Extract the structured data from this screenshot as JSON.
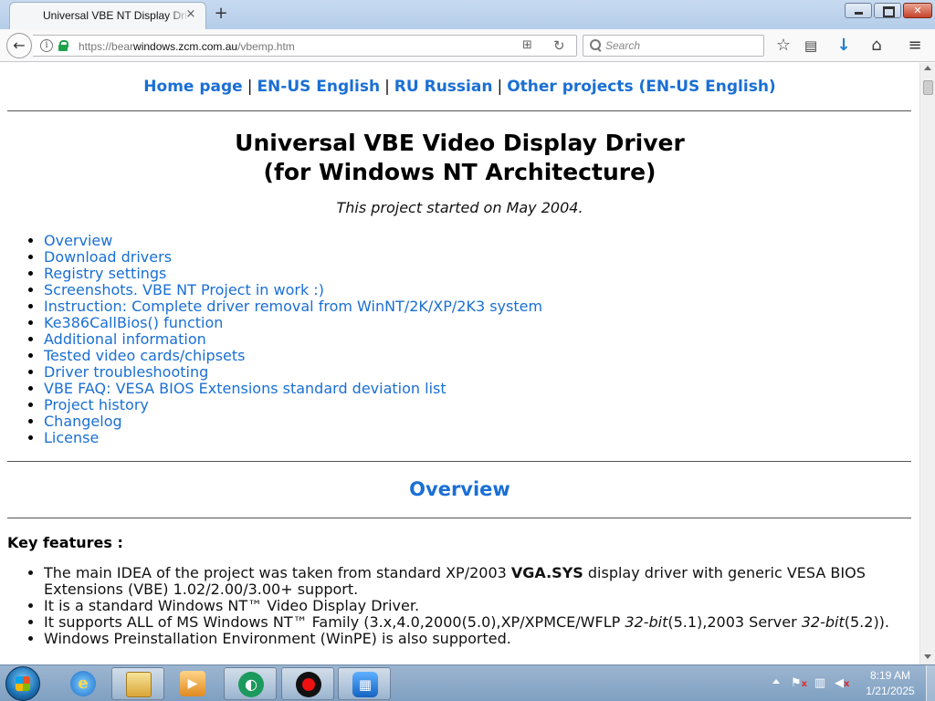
{
  "browser": {
    "tab_title": "Universal VBE NT Display Driver",
    "tab_close": "×",
    "new_tab": "+",
    "url_prefix": "https://bear",
    "url_host": "windows.zcm.com.au",
    "url_path": "/vbemp.htm",
    "search_placeholder": "Search",
    "back_glyph": "←",
    "reader_glyph": "⊞",
    "reload_glyph": "↻",
    "star_glyph": "☆",
    "library_glyph": "▤",
    "download_glyph": "↓",
    "home_glyph": "⌂",
    "menu_glyph": "≡",
    "info_glyph": "i"
  },
  "topnav": {
    "links": [
      "Home page",
      "EN-US English",
      "RU Russian",
      "Other projects (EN-US English)"
    ],
    "separator": "|"
  },
  "page": {
    "title_line1": "Universal VBE Video Display Driver",
    "title_line2": "(for Windows NT Architecture)",
    "subtitle": "This project started on May 2004.",
    "toc": [
      "Overview",
      "Download drivers",
      "Registry settings",
      "Screenshots. VBE NT Project in work :)",
      "Instruction: Complete driver removal from WinNT/2K/XP/2K3 system",
      "Ke386CallBios() function",
      "Additional information",
      "Tested video cards/chipsets",
      "Driver troubleshooting",
      "VBE FAQ: VESA BIOS Extensions standard deviation list",
      "Project history",
      "Changelog",
      "License"
    ],
    "overview_heading": "Overview",
    "key_features_label": "Key features :",
    "features": {
      "f1_before": "The main IDEA of the project was taken from standard XP/2003 ",
      "f1_bold": "VGA.SYS",
      "f1_after": " display driver with generic VESA BIOS Extensions (VBE) 1.02/2.00/3.00+ support.",
      "f2": "It is a standard Windows NT™ Video Display Driver.",
      "f3_a": "It supports ALL of MS Windows NT™ Family (3.x,4.0,2000(5.0),XP/XPMCE/WFLP ",
      "f3_i1": "32-bit",
      "f3_b": "(5.1),2003 Server ",
      "f3_i2": "32-bit",
      "f3_c": "(5.2)).",
      "f4": "Windows Preinstallation Environment (WinPE) is also supported."
    }
  },
  "taskbar": {
    "ie_glyph": "e",
    "media_glyph": "▶",
    "app1_glyph": "◐",
    "film_glyph": "▦",
    "tray_flag": "⚑",
    "tray_network": "▥",
    "tray_volume": "◀",
    "tray_x": "x",
    "clock_time": "8:19 AM",
    "clock_date": "1/21/2025"
  },
  "colors": {
    "link": "#1a6fd4",
    "lock": "#1fa34a",
    "download": "#1d7fd0"
  }
}
